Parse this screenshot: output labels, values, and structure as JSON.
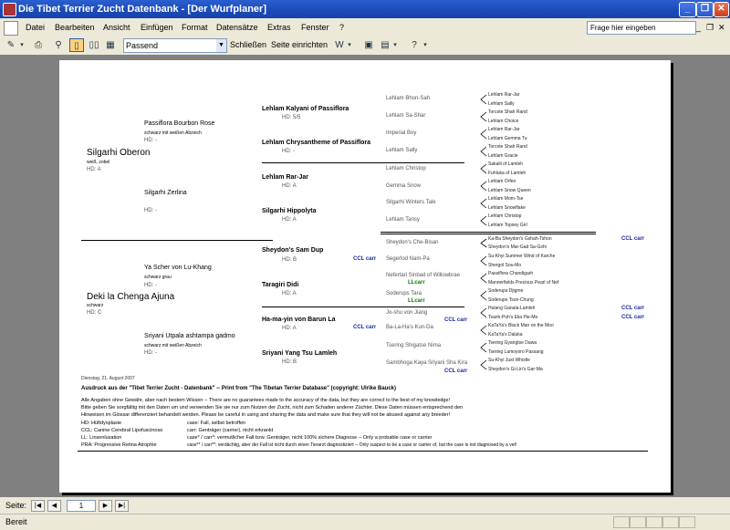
{
  "window": {
    "title": "Die Tibet Terrier Zucht Datenbank - [Der Wurfplaner]"
  },
  "menu": [
    "Datei",
    "Bearbeiten",
    "Ansicht",
    "Einfügen",
    "Format",
    "Datensätze",
    "Extras",
    "Fenster",
    "?"
  ],
  "help_placeholder": "Frage hier eingeben",
  "toolbar": {
    "zoom": "Passend",
    "close_label": "Schließen",
    "page_setup_label": "Seite einrichten"
  },
  "report": {
    "sire": {
      "name": "Silgarhi Oberon",
      "color": "weiß, zobel",
      "hd": "HD: A"
    },
    "sire_sire": {
      "name": "Passiflora Bourbon Rose",
      "color": "schwarz mit weißen Abzeich",
      "hd": "HD: -"
    },
    "sire_dam": {
      "name": "Silgarhi Zerlina",
      "hd": "HD: -"
    },
    "dam": {
      "name": "Deki la Chenga Ajuna",
      "color": "schwarz",
      "hd": "HD: C"
    },
    "dam_sire": {
      "name": "Ya Scher von Lu-Khang",
      "color": "schwarz grau",
      "hd": "HD: -"
    },
    "dam_dam": {
      "name": "Sriyani Utpala ashtampa gadmo",
      "color": "schwarz mit weißen Abzeich",
      "hd": "HD: -"
    },
    "gen3": [
      {
        "name": "Lehlam Kalyani of Passiflora",
        "hd": "HD: 5/5"
      },
      {
        "name": "Lehlam Chrysantheme of Passiflora",
        "hd": "HD: -"
      },
      {
        "name": "Lehlam Rar-Jar",
        "hd": "HD: A"
      },
      {
        "name": "Silgarhi Hippolyta",
        "hd": "HD: A"
      },
      {
        "name": "Sheydon's Sam Dup",
        "hd": "HD: B",
        "mark": "CCL carr"
      },
      {
        "name": "Taragiri Didi",
        "hd": "HD: A"
      },
      {
        "name": "Ha-ma-yin von Barun La",
        "hd": "HD: A",
        "mark": "CCL carr"
      },
      {
        "name": "Sriyani Yang Tsu Lamleh",
        "hd": "HD: B"
      }
    ],
    "gen4": [
      {
        "name": "Lehlam Bhon-Sah"
      },
      {
        "name": "Lehlam Sa-Shar"
      },
      {
        "name": "Imperial Boy"
      },
      {
        "name": "Lehlam Sally"
      },
      {
        "name": "Lehlam Christop"
      },
      {
        "name": "Gemma Snow"
      },
      {
        "name": "Silgarhi Winters Tale"
      },
      {
        "name": "Lehlam Tansy"
      },
      {
        "name": "Sheydon's Che-Bisan"
      },
      {
        "name": "Segerlod Nam-Pa"
      },
      {
        "name": "Nefertari Sinbad of Willowbrae",
        "mark": "LLcarr"
      },
      {
        "name": "Soderups Tara",
        "mark": "LLcarr"
      },
      {
        "name": "Jo-shu von Jiang"
      },
      {
        "name": "Ba-La-Ha's Kun-Da",
        "mark": "CCL carr"
      },
      {
        "name": "Tsering Shigatse Nima"
      },
      {
        "name": "Sambhoga Kaya Sriyani Sha Kira",
        "mark": "CCL carr"
      }
    ],
    "gen5": [
      {
        "name": "Lehlam Rar-Jar"
      },
      {
        "name": "Lehlam Sally"
      },
      {
        "name": "Torcote Shah Rand"
      },
      {
        "name": "Lehlam Choice"
      },
      {
        "name": "Lehlam Rar-Jar"
      },
      {
        "name": "Lehlam Gemma Tu"
      },
      {
        "name": "Torcote Shah Rand"
      },
      {
        "name": "Lehlam Gracie"
      },
      {
        "name": "Sakalil of Lamleh"
      },
      {
        "name": "Fuhluka of Lamleh"
      },
      {
        "name": "Lehlam Orfeo"
      },
      {
        "name": "Lehlam Snow Queen"
      },
      {
        "name": "Lehlam Mom-Tse"
      },
      {
        "name": "Lehlam Snowflake"
      },
      {
        "name": "Lehlam Christop"
      },
      {
        "name": "Lehlam Topsey Girl"
      },
      {
        "name": "Ka-Ba Sheydon's Gshah-Tshon",
        "mark": "CCL carr"
      },
      {
        "name": "Sheydon's Mar-Gad Sa-Gshi"
      },
      {
        "name": "Su-Khyi Summer Wind of Karche"
      },
      {
        "name": "Shergol Sou-Mo"
      },
      {
        "name": "Passiflora Chandigarh"
      },
      {
        "name": "Mannerfields Precious Pearl of Nef"
      },
      {
        "name": "Soderups Djigme"
      },
      {
        "name": "Soderups Tsun-Chung"
      },
      {
        "name": "Hulang Ganala-Lamleh",
        "mark": "CCL carr"
      },
      {
        "name": "Tsanh-Poh's Elia Pie-Mo",
        "mark": "CCL carr"
      },
      {
        "name": "KaTaYa's Black Man on the Moo"
      },
      {
        "name": "KaTaYa's Daluka"
      },
      {
        "name": "Tsering Gyangtse Dawa"
      },
      {
        "name": "Tsering Lamoyoro Passang"
      },
      {
        "name": "Su-Khyi Just Whistle"
      },
      {
        "name": "Sheydon's Gi-Lin's Gar-Ma"
      }
    ],
    "footer": {
      "date": "Dienstag, 21. August 2007",
      "source": "Ausdruck aus der \"Tibet Terrier Zucht - Datenbank\" -- Print from \"The Tibetan Terrier Database\"  (copyright: Ulrike Bauck)",
      "disclaimer": [
        "Alle Angaben ohne Gewähr, aber nach bestem Wissen -- There are no guarantees made to the accuracy of the data, but they are correct to the best of my knowledge!",
        "Bitte geben Sie sorgfältig mit den Daten um und verwenden Sie sie nur zum Nutzen der Zucht, nicht zum Schaden anderer Züchter. Diese Daten müssen entsprechend den",
        "Hinweisen im Glossar differenziert behandelt werden. Please be careful in using and sharing the data and make sure that they will not be abused against any breeder!"
      ],
      "legend": [
        {
          "abbr": "HD:   Hüftdysplasie",
          "desc": "case:   Fall, selbst betroffen"
        },
        {
          "abbr": "CCL: Canine Cerebral Lipofuscinose",
          "desc": "carr:   Genträger (carrier), nicht erkrankt"
        },
        {
          "abbr": "LL:    Linsenluxation",
          "desc": "case* / carr*: vermutlicher Fall bzw. Genträger, nicht 100% sichere Diagnose -- Only a probable case or carrier"
        },
        {
          "abbr": "PRA: Progressive Retina Atrophie",
          "desc": "case** / carr**: verdächtig, aber der Fall ist nicht durch einen Tierarzt diagnostiziert -- Only suspect to be a case or carrier of, but the case is not diagnosed by a vet!"
        }
      ]
    }
  },
  "nav": {
    "label": "Seite:",
    "page": "1"
  },
  "status": {
    "text": "Bereit"
  }
}
